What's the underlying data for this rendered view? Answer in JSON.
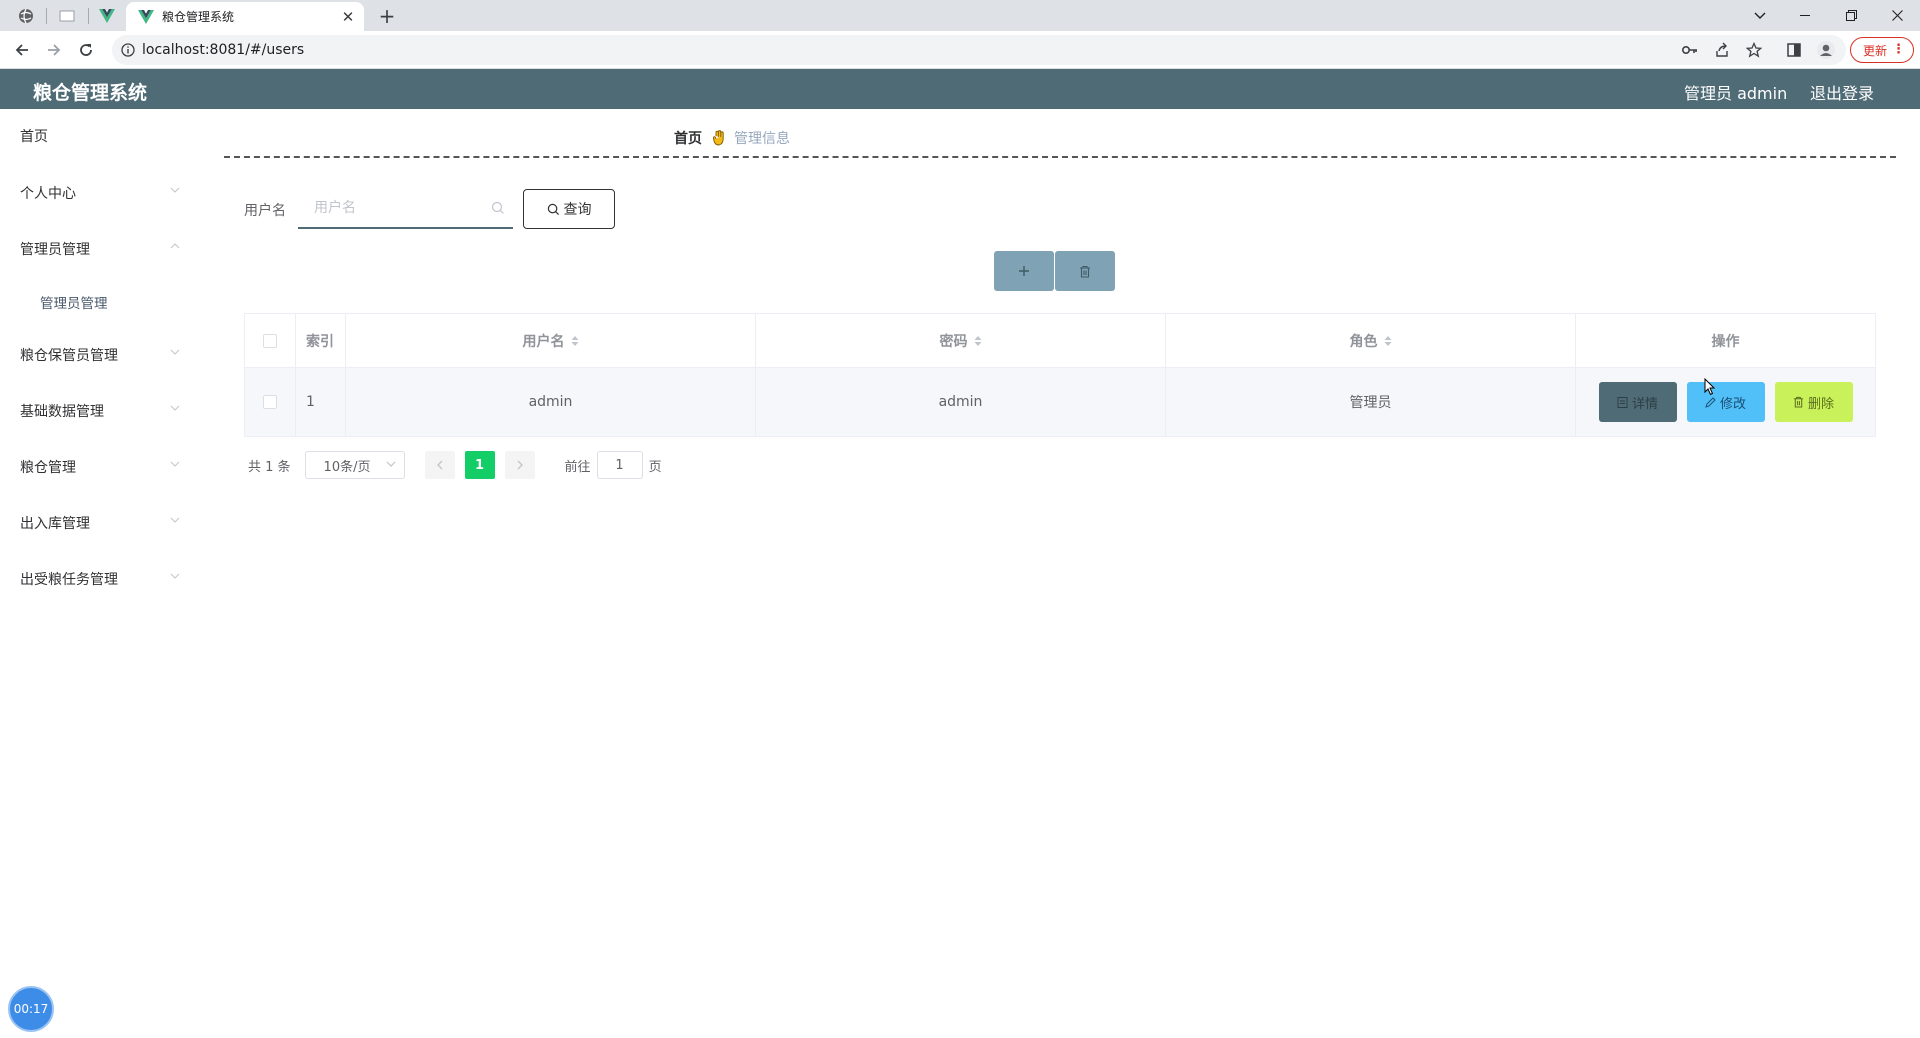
{
  "browser": {
    "tab_title": "粮仓管理系统",
    "url": "localhost:8081/#/users",
    "update_label": "更新"
  },
  "header": {
    "title": "粮仓管理系统",
    "user": "管理员 admin",
    "logout": "退出登录"
  },
  "sidebar": {
    "items": [
      {
        "label": "首页",
        "expandable": false
      },
      {
        "label": "个人中心",
        "expandable": true,
        "expanded": false
      },
      {
        "label": "管理员管理",
        "expandable": true,
        "expanded": true
      },
      {
        "label": "管理员管理",
        "sub": true
      },
      {
        "label": "粮仓保管员管理",
        "expandable": true,
        "expanded": false
      },
      {
        "label": "基础数据管理",
        "expandable": true,
        "expanded": false
      },
      {
        "label": "粮仓管理",
        "expandable": true,
        "expanded": false
      },
      {
        "label": "出入库管理",
        "expandable": true,
        "expanded": false
      },
      {
        "label": "出受粮任务管理",
        "expandable": true,
        "expanded": false
      }
    ]
  },
  "breadcrumb": {
    "home": "首页",
    "current": "管理信息"
  },
  "search": {
    "label": "用户名",
    "placeholder": "用户名",
    "button": "查询"
  },
  "table": {
    "headers": {
      "index": "索引",
      "username": "用户名",
      "password": "密码",
      "role": "角色",
      "operation": "操作"
    },
    "rows": [
      {
        "index": "1",
        "username": "admin",
        "password": "admin",
        "role": "管理员"
      }
    ],
    "actions": {
      "detail": "详情",
      "edit": "修改",
      "delete": "删除"
    }
  },
  "pagination": {
    "total": "共 1 条",
    "page_size": "10条/页",
    "current_page": "1",
    "goto_prefix": "前往",
    "goto_value": "1",
    "goto_suffix": "页"
  },
  "timer": "00:17",
  "colors": {
    "header_bg": "#4f6b76",
    "action_btn_bg": "#7fa3b4",
    "detail_btn": "#4f6b76",
    "edit_btn": "#52c0f8",
    "delete_btn": "#c9f15a",
    "active_page": "#13ce66"
  }
}
